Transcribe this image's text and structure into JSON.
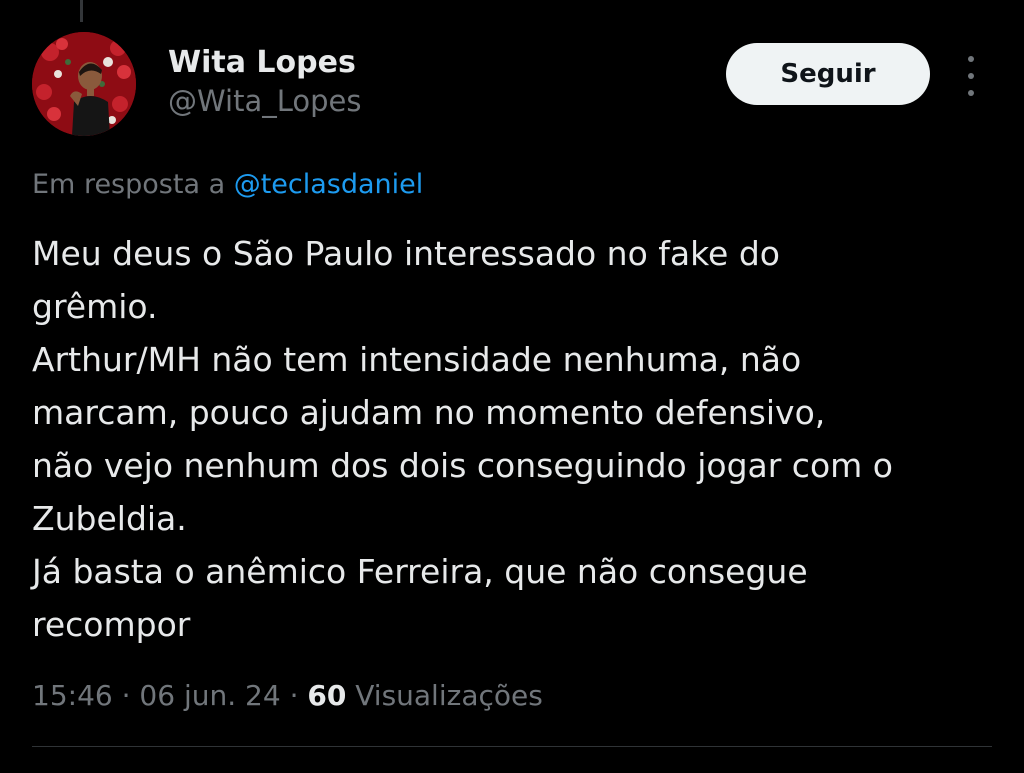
{
  "author": {
    "display_name": "Wita Lopes",
    "handle": "@Wita_Lopes",
    "avatar_icon": "profile-photo"
  },
  "actions": {
    "follow_label": "Seguir",
    "more_icon": "more-options-icon"
  },
  "reply": {
    "prefix": "Em resposta a",
    "mention": "@teclasdaniel"
  },
  "tweet": {
    "lines": [
      "Meu deus o São Paulo interessado no fake do",
      "grêmio.",
      "Arthur/MH não tem intensidade nenhuma, não",
      "marcam, pouco ajudam no momento defensivo,",
      "não vejo nenhum dos dois conseguindo jogar com o",
      "Zubeldia.",
      "Já basta o anêmico Ferreira, que não consegue",
      "recompor"
    ]
  },
  "meta": {
    "time": "15:46",
    "separator": "·",
    "date": "06 jun. 24",
    "views_count": "60",
    "views_label": "Visualizações"
  },
  "colors": {
    "background": "#000000",
    "text_primary": "#e7e9ea",
    "text_secondary": "#71767b",
    "link": "#1d9bf0",
    "button_bg": "#eff3f4"
  }
}
